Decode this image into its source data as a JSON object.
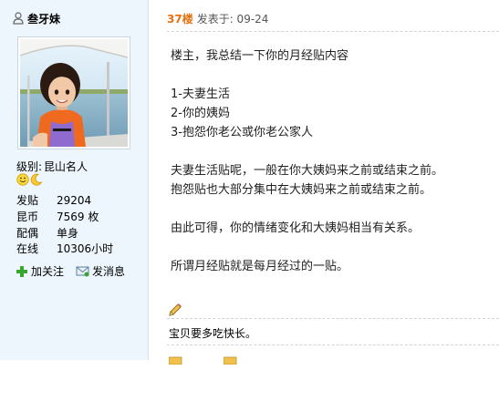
{
  "sidebar": {
    "username": "叁牙妹",
    "level_label": "级别:",
    "level_value": "昆山名人",
    "stats": [
      {
        "label": "发贴",
        "value": "29204"
      },
      {
        "label": "昆币",
        "value": "7569 枚"
      },
      {
        "label": "配偶",
        "value": "单身"
      },
      {
        "label": "在线",
        "value": "10306小时"
      }
    ],
    "add_follow": "加关注",
    "send_message": "发消息"
  },
  "post": {
    "floor": "37楼",
    "posted_at": "发表于: 09-24",
    "lines": [
      "楼主，我总结一下你的月经贴内容",
      "",
      "1-夫妻生活",
      "2-你的姨妈",
      "3-抱怨你老公或你老公家人",
      "",
      "夫妻生活贴呢，一般在你大姨妈来之前或结束之前。",
      "抱怨贴也大部分集中在大姨妈来之前或结束之前。",
      "",
      "由此可得，你的情绪变化和大姨妈相当有关系。",
      "",
      "所谓月经贴就是每月经过的一贴。"
    ],
    "signature": "宝贝要多吃快长。"
  },
  "colors": {
    "floor": "#e8700e",
    "sidebar_bg": "#edf6fd"
  }
}
